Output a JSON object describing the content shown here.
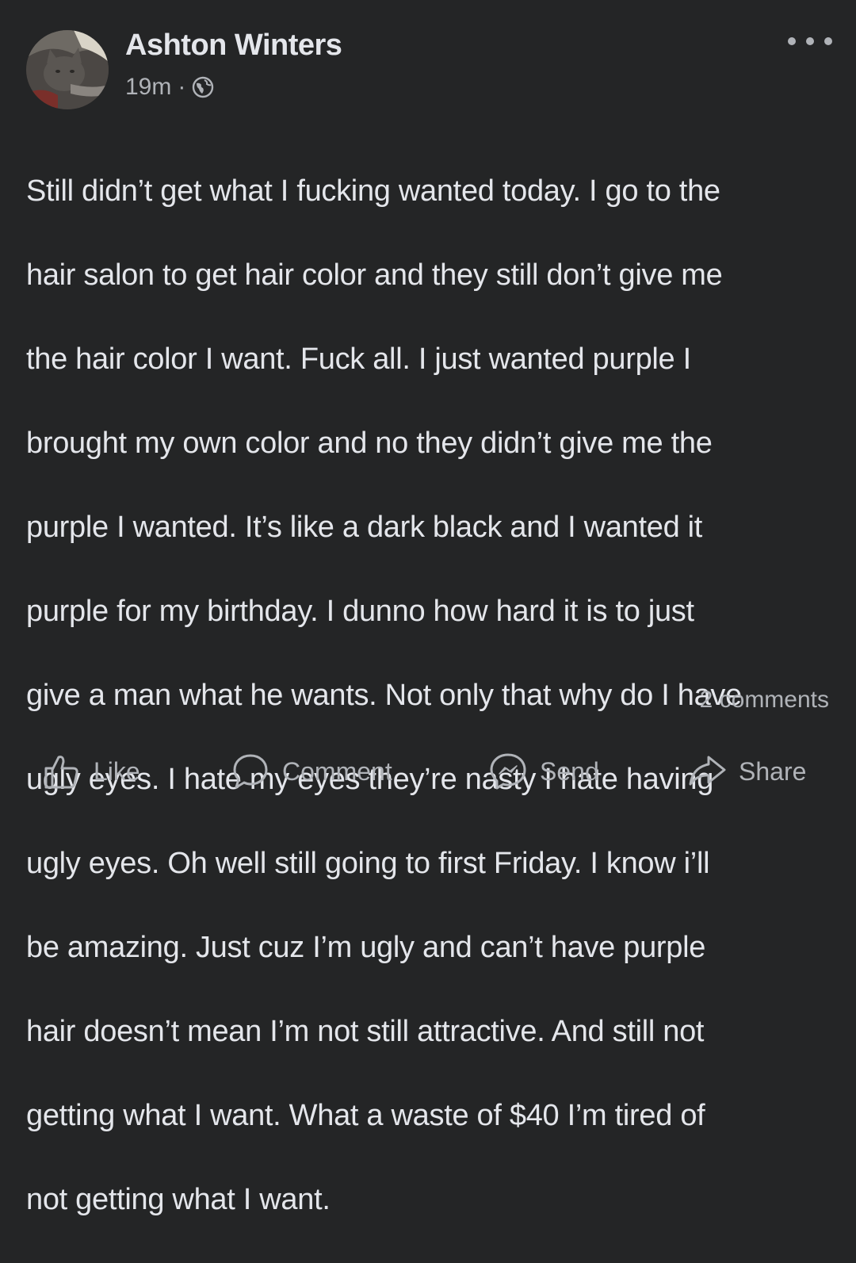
{
  "post": {
    "author": "Ashton Winters",
    "time": "19m",
    "separator": "·",
    "visibility_icon": "globe-icon",
    "more_icon": "more-options-icon",
    "body_lines": [
      "Still didn’t get what I fucking wanted today.  I go to the",
      "hair salon to get hair color and they still don’t give me",
      "the hair color I want.  Fuck all.  I just wanted purple I",
      "brought my own color and no they didn’t give me the",
      "purple I wanted.  It’s like a dark black and I wanted it",
      "purple for my birthday.  I dunno how hard it is to just",
      "give a man what he wants.  Not only that why do I have",
      "ugly eyes.  I hate my eyes they’re nasty I hate having",
      "ugly eyes.  Oh well still going to first Friday.  I know i’ll",
      "be amazing.  Just cuz I’m ugly and can’t have purple",
      "hair doesn’t mean I’m not still attractive. And still not",
      "getting what I want.  What a waste of $40 I’m tired of",
      "not getting what I want."
    ],
    "comments_count": "2 comments"
  },
  "actions": {
    "like": {
      "label": "Like",
      "icon": "thumbs-up-icon"
    },
    "comment": {
      "label": "Comment",
      "icon": "speech-bubble-icon"
    },
    "send": {
      "label": "Send",
      "icon": "messenger-icon"
    },
    "share": {
      "label": "Share",
      "icon": "share-arrow-icon"
    }
  },
  "colors": {
    "background": "#242526",
    "primary_text": "#e4e6eb",
    "secondary_text": "#b0b3b8"
  }
}
